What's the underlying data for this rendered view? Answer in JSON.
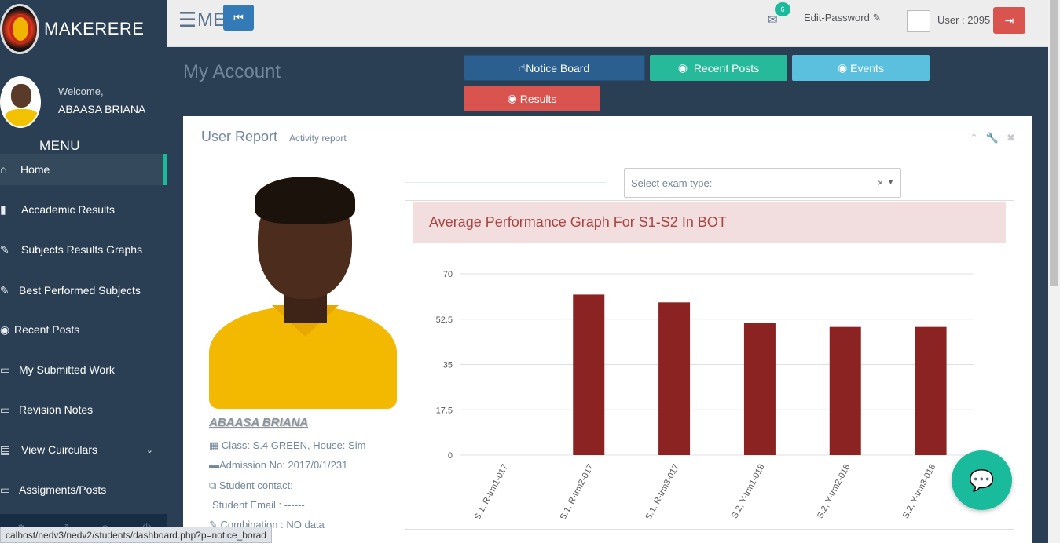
{
  "brand": {
    "name": "MAKERERE"
  },
  "profile": {
    "welcome": "Welcome,",
    "name": "ABAASA BRIANA"
  },
  "sidebar": {
    "menu_title": "MENU",
    "items": [
      {
        "label": "Home",
        "icon": "home-icon",
        "glyph": "⌂"
      },
      {
        "label": "Accademic Results",
        "icon": "file-icon",
        "glyph": "▮"
      },
      {
        "label": "Subjects Results Graphs",
        "icon": "edit-icon",
        "glyph": "✎"
      },
      {
        "label": "Best Performed Subjects",
        "icon": "edit-icon",
        "glyph": "✎"
      },
      {
        "label": "Recent Posts",
        "icon": "dot-circle-icon",
        "glyph": "◉"
      },
      {
        "label": "My Submitted Work",
        "icon": "desktop-icon",
        "glyph": "▭"
      },
      {
        "label": "Revision Notes",
        "icon": "desktop-icon",
        "glyph": "▭"
      },
      {
        "label": "View Cuirculars",
        "icon": "book-icon",
        "glyph": "▤"
      },
      {
        "label": "Assigments/Posts",
        "icon": "desktop-icon",
        "glyph": "▭"
      }
    ]
  },
  "topbar": {
    "menu_text": "ME",
    "mail_count": "6",
    "edit_password": "Edit-Password",
    "user_label": "User : 2095"
  },
  "page": {
    "title": "My Account",
    "buttons": {
      "notice": "Notice Board",
      "recent": "Recent Posts",
      "events": "Events",
      "results": "Results"
    }
  },
  "panel": {
    "title": "User Report",
    "subtitle": "Activity report",
    "student_name": "ABAASA BRIANA",
    "class_house": "Class: S.4 GREEN, House: Sim",
    "admission": "Admission No: 2017/0/1/231",
    "contact": "Student contact:",
    "email": "Student Email : ------",
    "combination": "Combination : NO data",
    "exam_select_placeholder": "Select exam type:"
  },
  "status_url": "calhost/nedv3/nedv2/students/dashboard.php?p=notice_borad",
  "colors": {
    "bar": "#8b2323",
    "accent": "#1abb9c"
  },
  "chart_data": {
    "type": "bar",
    "title": "Average Performance Graph For S1-S2 In BOT",
    "categories": [
      "S.1, R-trm1-017",
      "S.1, R-trm2-017",
      "S.1, R-trm3-017",
      "S.2, Y-trm1-018",
      "S.2, Y-trm2-018",
      "S.2, Y-trm3-018"
    ],
    "values": [
      0,
      62,
      59,
      51,
      49.5,
      49.5
    ],
    "ylim": [
      0,
      70
    ],
    "yticks": [
      "0",
      "17.5",
      "35",
      "52.5",
      "70"
    ],
    "grid": true
  }
}
